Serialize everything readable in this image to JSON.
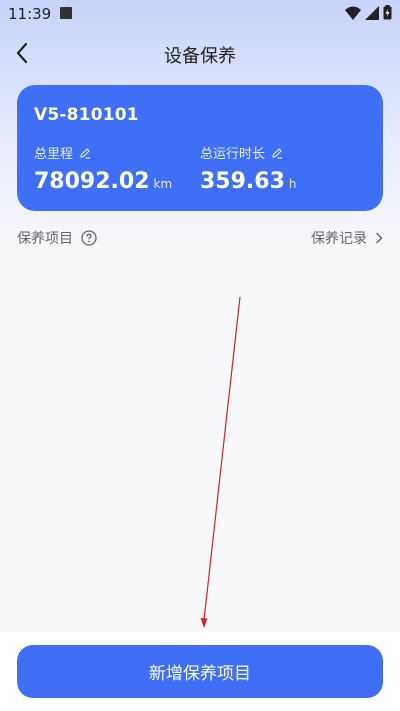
{
  "status_bar": {
    "time": "11:39"
  },
  "header": {
    "title": "设备保养"
  },
  "card": {
    "device_id": "V5-810101",
    "mileage": {
      "label": "总里程",
      "value": "78092.02",
      "unit": "km"
    },
    "runtime": {
      "label": "总运行时长",
      "value": "359.63",
      "unit": "h"
    }
  },
  "section": {
    "items_label": "保养项目",
    "records_label": "保养记录"
  },
  "footer": {
    "add_button_label": "新增保养项目"
  },
  "colors": {
    "accent": "#3f6ff7",
    "annotation_arrow": "#c62828"
  }
}
